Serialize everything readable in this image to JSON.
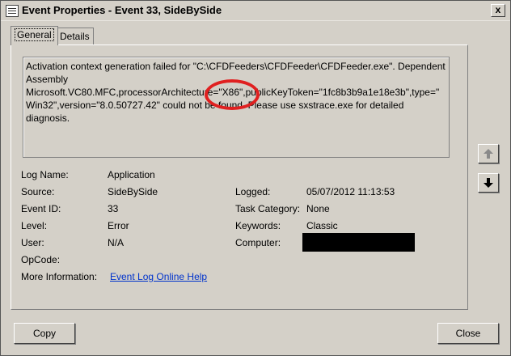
{
  "window": {
    "title": "Event Properties - Event 33, SideBySide",
    "close_label": "x"
  },
  "tabs": [
    {
      "label": "General",
      "active": true
    },
    {
      "label": "Details",
      "active": false
    }
  ],
  "description": "Activation context generation failed for \"C:\\CFDFeeders\\CFDFeeder\\CFDFeeder.exe\". Dependent Assembly Microsoft.VC80.MFC,processorArchitecture=\"X86\",publicKeyToken=\"1fc8b3b9a1e18e3b\",type=\"Win32\",version=\"8.0.50727.42\" could not be found. Please use sxstrace.exe for detailed diagnosis.",
  "fields": {
    "log_name": {
      "label": "Log Name:",
      "value": "Application"
    },
    "source": {
      "label": "Source:",
      "value": "SideBySide"
    },
    "event_id": {
      "label": "Event ID:",
      "value": "33"
    },
    "level": {
      "label": "Level:",
      "value": "Error"
    },
    "user": {
      "label": "User:",
      "value": "N/A"
    },
    "opcode": {
      "label": "OpCode:",
      "value": ""
    },
    "more_info": {
      "label": "More Information:",
      "value": "Event Log Online Help"
    },
    "logged": {
      "label": "Logged:",
      "value": "05/07/2012 11:13:53"
    },
    "task_category": {
      "label": "Task Category:",
      "value": "None"
    },
    "keywords": {
      "label": "Keywords:",
      "value": "Classic"
    },
    "computer": {
      "label": "Computer:",
      "value": ""
    }
  },
  "buttons": {
    "copy": "Copy",
    "close": "Close"
  },
  "icons": {
    "up": "arrow-up-icon",
    "down": "arrow-down-icon"
  },
  "colors": {
    "annotation": "#e02020",
    "link": "#0033cc"
  }
}
